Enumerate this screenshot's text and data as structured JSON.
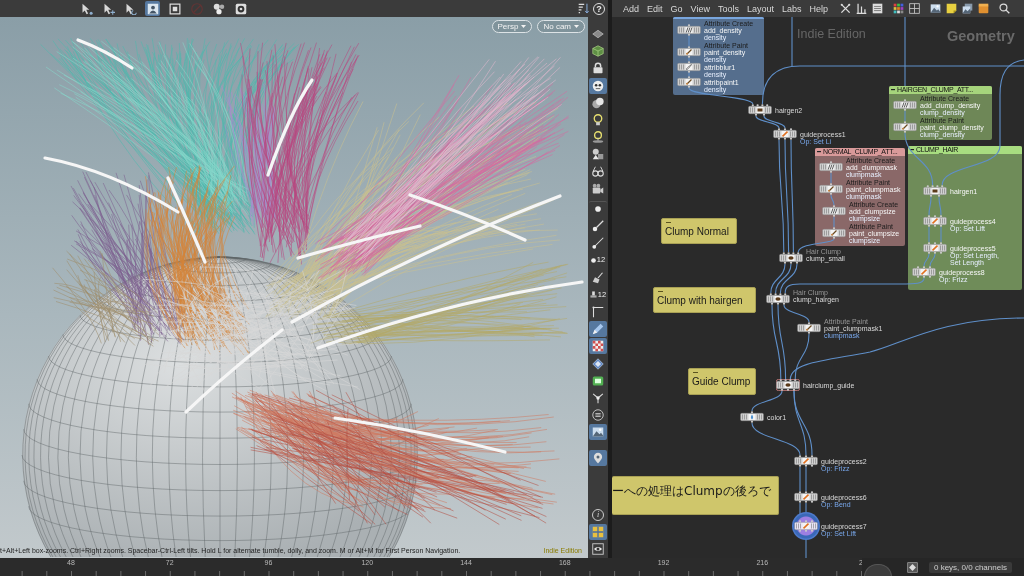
{
  "viewport_toolbar": {
    "tools": [
      {
        "kind": "select-arrow",
        "on": false
      },
      {
        "kind": "move-arrow",
        "on": false
      },
      {
        "kind": "rotate-arrow",
        "on": false
      },
      {
        "kind": "scene",
        "on": true
      },
      {
        "kind": "square",
        "on": false
      },
      {
        "kind": "no-entry",
        "on": false
      },
      {
        "kind": "gears",
        "on": false
      },
      {
        "kind": "gear-box",
        "on": false
      }
    ],
    "right_tools": [
      {
        "kind": "sort"
      },
      {
        "kind": "help",
        "label": "?"
      }
    ]
  },
  "viewport": {
    "camera_menus": [
      {
        "label": "Persp"
      },
      {
        "label": "No cam"
      }
    ],
    "status_message": "t+Alt+Left box-zooms. Ctrl+Right zooms. Spacebar-Ctrl-Left tilts. Hold L for alternate tumble, dolly, and zoom. M or Alt+M for First Person Navigation.",
    "edition_label": "Indie Edition"
  },
  "viewport_side_toolbar": [
    {
      "kind": "plane",
      "on": false
    },
    {
      "kind": "cube",
      "on": false
    },
    {
      "kind": "lock",
      "on": false
    },
    {
      "kind": "ghost",
      "on": true
    },
    {
      "kind": "spheres",
      "on": false
    },
    {
      "kind": "bulb",
      "on": false
    },
    {
      "kind": "lamp",
      "on": false
    },
    {
      "kind": "shapes",
      "on": false
    },
    {
      "kind": "glasses",
      "on": false
    },
    {
      "kind": "camera",
      "on": false
    },
    {
      "kind": "dot",
      "on": false
    },
    {
      "kind": "brush-dot",
      "on": false
    },
    {
      "kind": "needle",
      "on": false
    },
    {
      "kind": "numbered-points",
      "on": false,
      "badge": "12"
    },
    {
      "kind": "broom",
      "on": false
    },
    {
      "kind": "numbered-stamp",
      "on": false,
      "badge": "12"
    },
    {
      "kind": "angle",
      "on": false
    },
    {
      "kind": "pen",
      "on": true
    },
    {
      "kind": "checker",
      "on": true
    },
    {
      "kind": "diamond",
      "on": false
    },
    {
      "kind": "film",
      "on": false
    },
    {
      "kind": "fork",
      "on": false
    },
    {
      "kind": "circle-lines",
      "on": false
    },
    {
      "kind": "picture",
      "on": true
    },
    {
      "kind": "pin",
      "on": true
    },
    {
      "kind": "info",
      "on": false,
      "label": "i"
    },
    {
      "kind": "quad",
      "on": true
    },
    {
      "kind": "eye-box",
      "on": false
    }
  ],
  "network_editor": {
    "menu": [
      "Add",
      "Edit",
      "Go",
      "View",
      "Tools",
      "Layout",
      "Labs",
      "Help"
    ],
    "toolbar": [
      {
        "kind": "tools"
      },
      {
        "kind": "bars"
      },
      {
        "kind": "list"
      },
      {
        "kind": "color-grid"
      },
      {
        "kind": "grid"
      },
      {
        "kind": "image"
      },
      {
        "kind": "sticky"
      },
      {
        "kind": "image-stack"
      },
      {
        "kind": "box"
      },
      {
        "kind": "search"
      }
    ],
    "edition_label": "Indie Edition",
    "context_label": "Geometry",
    "network_boxes": [
      {
        "color": "#79a6de"
      },
      {
        "title": "HAIRGEN_CLUMP_ATT...",
        "color": "#a6d47c"
      },
      {
        "title": "NORMAL_CLUMP_ATT...",
        "color": "#d99a9a"
      },
      {
        "title": "CLUMP_HAIR",
        "color": "#a8dc80"
      }
    ],
    "sticky_notes": [
      {
        "text": "Clump Normal"
      },
      {
        "text": "Clump with hairgen"
      },
      {
        "text": "Guide Clump"
      },
      {
        "text": "ーへの処理はClumpの後ろで"
      }
    ],
    "nodes": [
      {
        "name": "add_density",
        "type": "Attribute Create",
        "sublabel": "density",
        "kind": "attribcreate",
        "selected": false,
        "outlined": false
      },
      {
        "name": "paint_density",
        "type": "Attribute Paint",
        "sublabel": "density",
        "kind": "attribpaint",
        "selected": false,
        "outlined": false
      },
      {
        "name": "attribblur1",
        "sublabel": "density",
        "kind": "attribblur",
        "selected": false,
        "outlined": false
      },
      {
        "name": "attribpaint1",
        "sublabel": "density",
        "kind": "attribpaint",
        "selected": false,
        "outlined": false
      },
      {
        "name": "hairgen2",
        "kind": "hairgen",
        "selected": false,
        "outlined": false
      },
      {
        "name": "guideprocess1",
        "sublabel": "Op: Set Li",
        "kind": "guideprocess",
        "selected": false,
        "outlined": false
      },
      {
        "name": "add_clump_density",
        "type": "Attribute Create",
        "sublabel": "clump_density",
        "kind": "attribcreate",
        "selected": false,
        "outlined": false
      },
      {
        "name": "paint_clump_density",
        "type": "Attribute Paint",
        "sublabel": "clump_density",
        "kind": "attribpaint",
        "selected": false,
        "outlined": false
      },
      {
        "name": "add_clumpmask",
        "type": "Attribute Create",
        "sublabel": "clumpmask",
        "kind": "attribcreate",
        "selected": false,
        "outlined": false
      },
      {
        "name": "paint_clumpmask",
        "type": "Attribute Paint",
        "sublabel": "clumpmask",
        "kind": "attribpaint",
        "selected": false,
        "outlined": false
      },
      {
        "name": "add_clumpsize",
        "type": "Attribute Create",
        "sublabel": "clumpsize",
        "kind": "attribcreate",
        "selected": false,
        "outlined": false
      },
      {
        "name": "paint_clumpsize",
        "type": "Attribute Paint",
        "sublabel": "clumpsize",
        "kind": "attribpaint",
        "selected": false,
        "outlined": false
      },
      {
        "name": "hairgen1",
        "kind": "hairgen",
        "selected": false,
        "outlined": false
      },
      {
        "name": "guideprocess4",
        "sublabel": "Op: Set Lift",
        "kind": "guideprocess",
        "selected": false,
        "outlined": false
      },
      {
        "name": "guideprocess5",
        "sublabel": "Op: Set Length, Set Length",
        "kind": "guideprocess",
        "selected": false,
        "outlined": false
      },
      {
        "name": "guideprocess8",
        "sublabel": "Op: Frizz",
        "kind": "guideprocess",
        "selected": false,
        "outlined": false
      },
      {
        "name": "clump_small",
        "type": "Hair Clump",
        "kind": "hairclump",
        "selected": false,
        "outlined": false
      },
      {
        "name": "clump_hairgen",
        "type": "Hair Clump",
        "kind": "hairclump",
        "selected": false,
        "outlined": false
      },
      {
        "name": "paint_clumpmask1",
        "type": "Attribute Paint",
        "sublabel": "clumpmask",
        "kind": "attribpaint",
        "selected": false,
        "outlined": false
      },
      {
        "name": "hairclump_guide",
        "kind": "hairclump",
        "selected": false,
        "outlined": true
      },
      {
        "name": "color1",
        "kind": "color",
        "selected": false,
        "outlined": false
      },
      {
        "name": "guideprocess2",
        "sublabel": "Op: Frizz",
        "kind": "guideprocess",
        "selected": false,
        "outlined": false
      },
      {
        "name": "guideprocess6",
        "sublabel": "Op: Bend",
        "kind": "guideprocess",
        "selected": false,
        "outlined": false
      },
      {
        "name": "guideprocess7",
        "sublabel": "Op: Set Lift",
        "kind": "guideprocess",
        "selected": true,
        "outlined": false
      }
    ]
  },
  "timeline": {
    "frame_labels": [
      "48",
      "72",
      "96",
      "120",
      "144",
      "168",
      "192",
      "216",
      "2"
    ],
    "channel_status": "0 keys, 0/0 channels"
  }
}
